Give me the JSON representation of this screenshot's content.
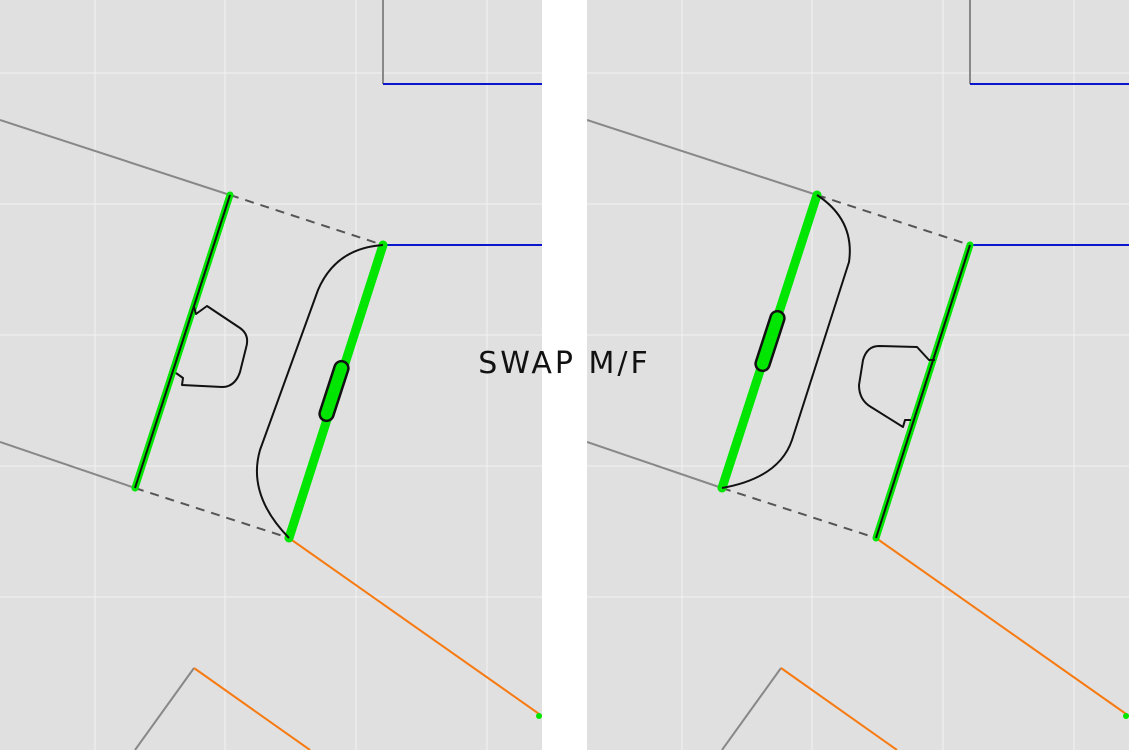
{
  "action": {
    "swap_label": "SWAP M/F"
  },
  "panels": [
    {
      "name": "before-swap",
      "male_side": "right",
      "female_side": "left"
    },
    {
      "name": "after-swap",
      "male_side": "left",
      "female_side": "right"
    }
  ],
  "colors": {
    "canvas": "#e0e0e0",
    "grid": "#f2f2f2",
    "edge_gray": "#888888",
    "edge_blue": "#0a16cc",
    "edge_orange": "#f77a10",
    "joint_green": "#00e600",
    "outline_black": "#111111",
    "dashed": "#555555",
    "divider": "#ffffff"
  }
}
